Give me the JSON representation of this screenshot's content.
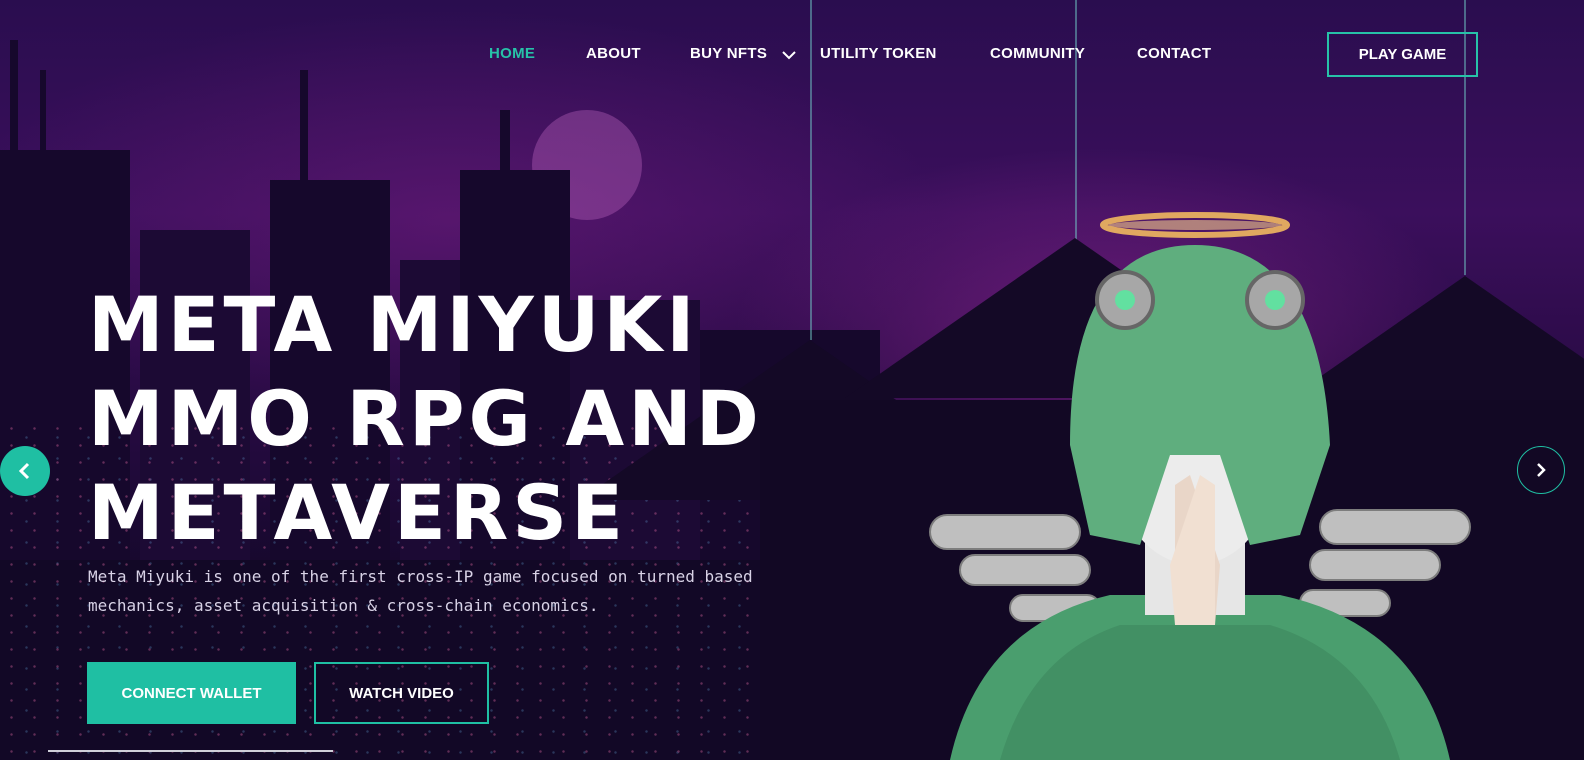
{
  "nav": {
    "items": [
      {
        "label": "HOME",
        "active": true
      },
      {
        "label": "ABOUT",
        "active": false
      },
      {
        "label": "BUY NFTS",
        "active": false,
        "has_dropdown": true
      },
      {
        "label": "UTILITY TOKEN",
        "active": false
      },
      {
        "label": "COMMUNITY",
        "active": false
      },
      {
        "label": "CONTACT",
        "active": false
      }
    ],
    "cta_label": "PLAY GAME"
  },
  "hero": {
    "title_lines": [
      "META MIYUKI",
      "MMO RPG AND",
      "METAVERSE"
    ],
    "description_lines": [
      "Meta Miyuki is one of the first cross-IP game focused on turned based",
      "mechanics, asset acquisition & cross-chain economics."
    ],
    "primary_button": "CONNECT WALLET",
    "secondary_button": "WATCH VIDEO",
    "character_image": "green-helmet-character-illustration"
  },
  "carousel": {
    "prev_icon": "chevron-left-icon",
    "next_icon": "chevron-right-icon"
  },
  "colors": {
    "accent": "#1fbfa3",
    "active_nav": "#27c2a8",
    "text": "#ffffff",
    "background": "#2a0d4f"
  }
}
